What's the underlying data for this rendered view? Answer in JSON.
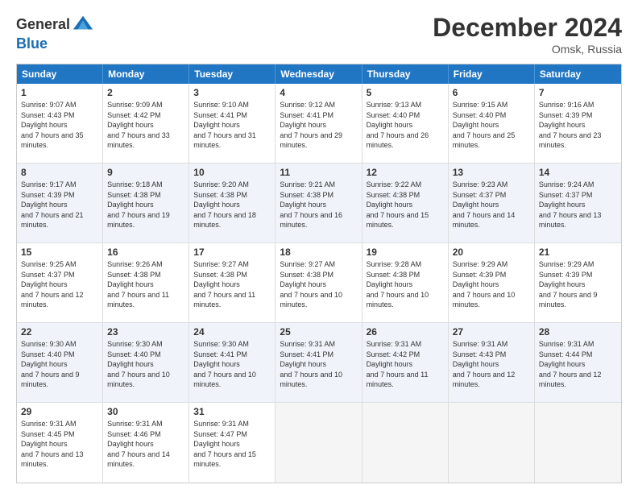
{
  "header": {
    "logo_general": "General",
    "logo_blue": "Blue",
    "month_title": "December 2024",
    "location": "Omsk, Russia"
  },
  "days_of_week": [
    "Sunday",
    "Monday",
    "Tuesday",
    "Wednesday",
    "Thursday",
    "Friday",
    "Saturday"
  ],
  "weeks": [
    [
      {
        "day": "1",
        "sunrise": "9:07 AM",
        "sunset": "4:43 PM",
        "daylight": "7 hours and 35 minutes."
      },
      {
        "day": "2",
        "sunrise": "9:09 AM",
        "sunset": "4:42 PM",
        "daylight": "7 hours and 33 minutes."
      },
      {
        "day": "3",
        "sunrise": "9:10 AM",
        "sunset": "4:41 PM",
        "daylight": "7 hours and 31 minutes."
      },
      {
        "day": "4",
        "sunrise": "9:12 AM",
        "sunset": "4:41 PM",
        "daylight": "7 hours and 29 minutes."
      },
      {
        "day": "5",
        "sunrise": "9:13 AM",
        "sunset": "4:40 PM",
        "daylight": "7 hours and 26 minutes."
      },
      {
        "day": "6",
        "sunrise": "9:15 AM",
        "sunset": "4:40 PM",
        "daylight": "7 hours and 25 minutes."
      },
      {
        "day": "7",
        "sunrise": "9:16 AM",
        "sunset": "4:39 PM",
        "daylight": "7 hours and 23 minutes."
      }
    ],
    [
      {
        "day": "8",
        "sunrise": "9:17 AM",
        "sunset": "4:39 PM",
        "daylight": "7 hours and 21 minutes."
      },
      {
        "day": "9",
        "sunrise": "9:18 AM",
        "sunset": "4:38 PM",
        "daylight": "7 hours and 19 minutes."
      },
      {
        "day": "10",
        "sunrise": "9:20 AM",
        "sunset": "4:38 PM",
        "daylight": "7 hours and 18 minutes."
      },
      {
        "day": "11",
        "sunrise": "9:21 AM",
        "sunset": "4:38 PM",
        "daylight": "7 hours and 16 minutes."
      },
      {
        "day": "12",
        "sunrise": "9:22 AM",
        "sunset": "4:38 PM",
        "daylight": "7 hours and 15 minutes."
      },
      {
        "day": "13",
        "sunrise": "9:23 AM",
        "sunset": "4:37 PM",
        "daylight": "7 hours and 14 minutes."
      },
      {
        "day": "14",
        "sunrise": "9:24 AM",
        "sunset": "4:37 PM",
        "daylight": "7 hours and 13 minutes."
      }
    ],
    [
      {
        "day": "15",
        "sunrise": "9:25 AM",
        "sunset": "4:37 PM",
        "daylight": "7 hours and 12 minutes."
      },
      {
        "day": "16",
        "sunrise": "9:26 AM",
        "sunset": "4:38 PM",
        "daylight": "7 hours and 11 minutes."
      },
      {
        "day": "17",
        "sunrise": "9:27 AM",
        "sunset": "4:38 PM",
        "daylight": "7 hours and 11 minutes."
      },
      {
        "day": "18",
        "sunrise": "9:27 AM",
        "sunset": "4:38 PM",
        "daylight": "7 hours and 10 minutes."
      },
      {
        "day": "19",
        "sunrise": "9:28 AM",
        "sunset": "4:38 PM",
        "daylight": "7 hours and 10 minutes."
      },
      {
        "day": "20",
        "sunrise": "9:29 AM",
        "sunset": "4:39 PM",
        "daylight": "7 hours and 10 minutes."
      },
      {
        "day": "21",
        "sunrise": "9:29 AM",
        "sunset": "4:39 PM",
        "daylight": "7 hours and 9 minutes."
      }
    ],
    [
      {
        "day": "22",
        "sunrise": "9:30 AM",
        "sunset": "4:40 PM",
        "daylight": "7 hours and 9 minutes."
      },
      {
        "day": "23",
        "sunrise": "9:30 AM",
        "sunset": "4:40 PM",
        "daylight": "7 hours and 10 minutes."
      },
      {
        "day": "24",
        "sunrise": "9:30 AM",
        "sunset": "4:41 PM",
        "daylight": "7 hours and 10 minutes."
      },
      {
        "day": "25",
        "sunrise": "9:31 AM",
        "sunset": "4:41 PM",
        "daylight": "7 hours and 10 minutes."
      },
      {
        "day": "26",
        "sunrise": "9:31 AM",
        "sunset": "4:42 PM",
        "daylight": "7 hours and 11 minutes."
      },
      {
        "day": "27",
        "sunrise": "9:31 AM",
        "sunset": "4:43 PM",
        "daylight": "7 hours and 12 minutes."
      },
      {
        "day": "28",
        "sunrise": "9:31 AM",
        "sunset": "4:44 PM",
        "daylight": "7 hours and 12 minutes."
      }
    ],
    [
      {
        "day": "29",
        "sunrise": "9:31 AM",
        "sunset": "4:45 PM",
        "daylight": "7 hours and 13 minutes."
      },
      {
        "day": "30",
        "sunrise": "9:31 AM",
        "sunset": "4:46 PM",
        "daylight": "7 hours and 14 minutes."
      },
      {
        "day": "31",
        "sunrise": "9:31 AM",
        "sunset": "4:47 PM",
        "daylight": "7 hours and 15 minutes."
      },
      null,
      null,
      null,
      null
    ]
  ]
}
